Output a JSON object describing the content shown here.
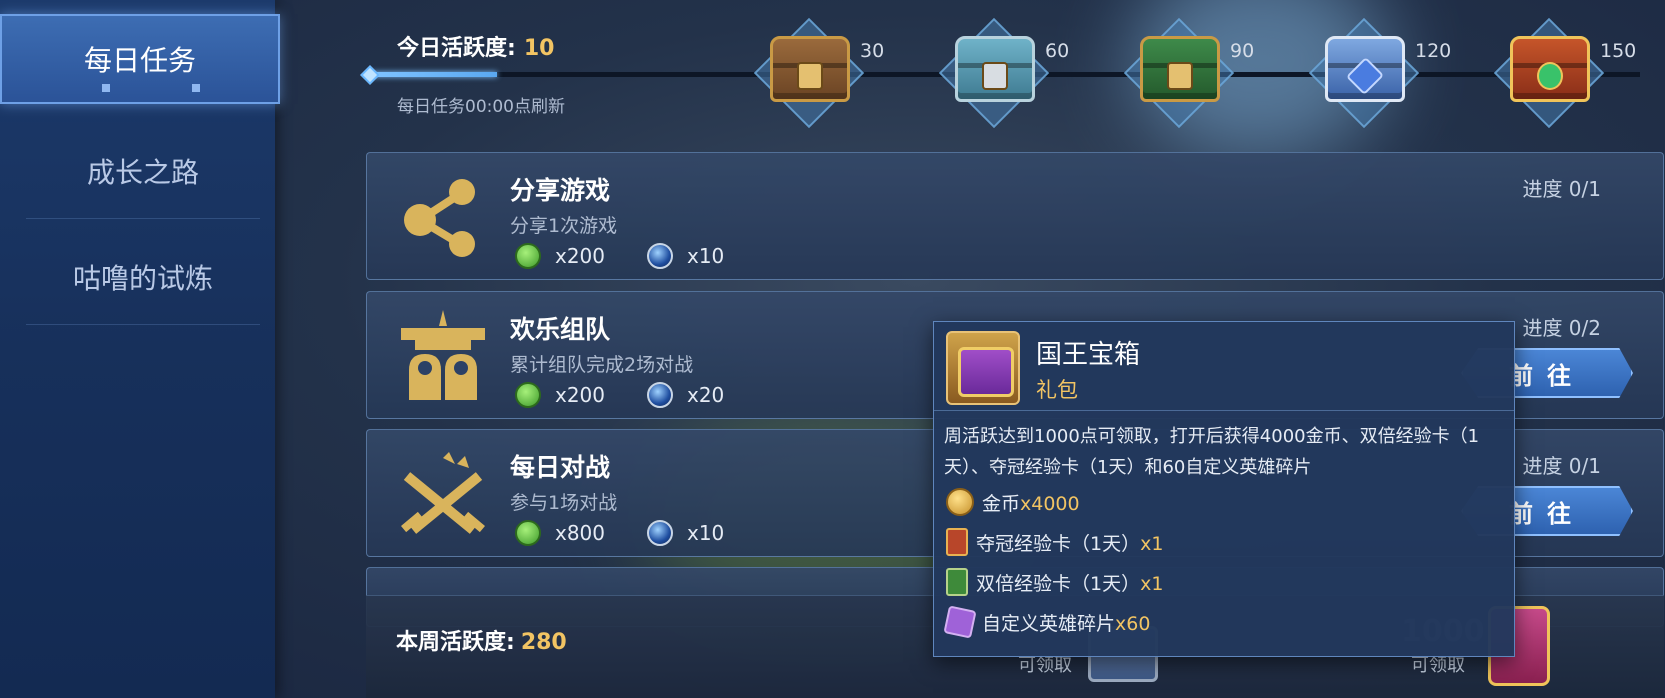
{
  "sidebar": {
    "items": [
      {
        "label": "每日任务",
        "active": true
      },
      {
        "label": "成长之路",
        "active": false
      },
      {
        "label": "咕噜的试炼",
        "active": false
      }
    ]
  },
  "activity": {
    "today_label": "今日活跃度:",
    "today_value": "10",
    "refresh_note": "每日任务00:00点刷新",
    "progress_fraction": 0.1,
    "milestones": [
      {
        "value": "30",
        "chest": "bronze-chest-icon"
      },
      {
        "value": "60",
        "chest": "silver-chest-icon"
      },
      {
        "value": "90",
        "chest": "green-gold-chest-icon"
      },
      {
        "value": "120",
        "chest": "blue-crystal-chest-icon"
      },
      {
        "value": "150",
        "chest": "emerald-gold-chest-icon"
      }
    ]
  },
  "tasks": [
    {
      "title": "分享游戏",
      "desc": "分享1次游戏",
      "exp": "x200",
      "orb": "x10",
      "progress": "进度  0/1",
      "button": ""
    },
    {
      "title": "欢乐组队",
      "desc": "累计组队完成2场对战",
      "exp": "x200",
      "orb": "x20",
      "progress": "进度  0/2",
      "button": "前往"
    },
    {
      "title": "每日对战",
      "desc": "参与1场对战",
      "exp": "x800",
      "orb": "x10",
      "progress": "进度  0/1",
      "button": "前往"
    }
  ],
  "weekly": {
    "label": "本周活跃度:",
    "value": "280",
    "claim_1": "可领取",
    "claim_2": "可领取",
    "milestone": "1000"
  },
  "popup": {
    "title": "国王宝箱",
    "subtitle": "礼包",
    "desc": "周活跃达到1000点可领取，打开后获得4000金币、双倍经验卡（1天）、夺冠经验卡（1天）和60自定义英雄碎片",
    "items": [
      {
        "name": "金币",
        "qty": "x4000"
      },
      {
        "name": "夺冠经验卡（1天）",
        "qty": "x1"
      },
      {
        "name": "双倍经验卡（1天）",
        "qty": "x1"
      },
      {
        "name": "自定义英雄碎片",
        "qty": "x60"
      }
    ]
  },
  "colors": {
    "accent_gold": "#f2c463",
    "active_tab": "#3d6db3",
    "panel_bg": "#2d4266"
  }
}
